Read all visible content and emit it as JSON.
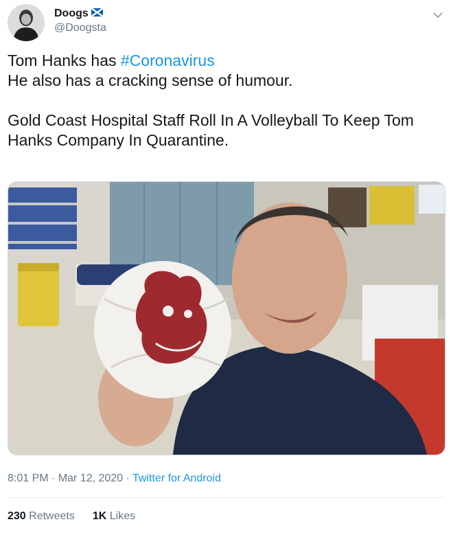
{
  "user": {
    "display_name": "Doogs",
    "handle": "@Doogsta",
    "flag_icon": "scottish-flag-icon"
  },
  "tweet": {
    "line1_prefix": "Tom Hanks has ",
    "hashtag": "#Coronavirus",
    "line2": "He also has a cracking sense of humour.",
    "paragraph2": "Gold Coast Hospital Staff Roll In A Volleyball To Keep Tom Hanks Company In Quarantine."
  },
  "meta": {
    "time": "8:01 PM",
    "sep1": " · ",
    "date": "Mar 12, 2020",
    "sep2": " · ",
    "source": "Twitter for Android"
  },
  "stats": {
    "retweets_count": "230",
    "retweets_label": "Retweets",
    "likes_count": "1K",
    "likes_label": "Likes"
  },
  "colors": {
    "link": "#1b95e0",
    "secondary": "#657786",
    "flag_blue": "#005eb8"
  }
}
